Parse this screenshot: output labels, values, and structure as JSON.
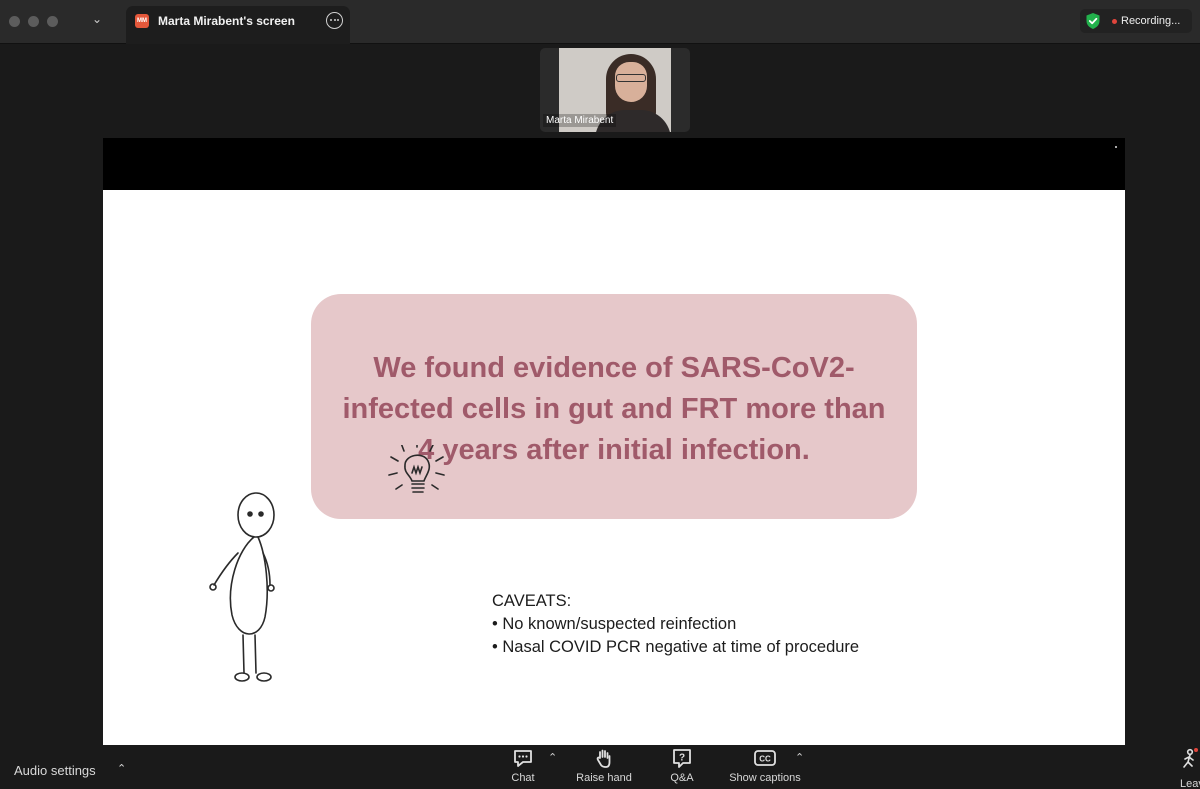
{
  "window": {
    "tab_title": "Marta Mirabent's screen",
    "app_icon_text": "MM",
    "recording_label": "Recording..."
  },
  "speaker": {
    "name": "Marta Mirabent"
  },
  "slide": {
    "headline_lines": [
      "We found evidence of SARS-CoV2-",
      "infected cells in gut and FRT more than",
      "4 years after initial infection."
    ],
    "caveats_title": "CAVEATS:",
    "caveats": [
      "• No known/suspected reinfection",
      "• Nasal COVID PCR negative at time of procedure"
    ],
    "colors": {
      "callout_bg": "#e6c8ca",
      "headline": "#a05a6a"
    }
  },
  "toolbar": {
    "audio_settings": "Audio settings",
    "chat": "Chat",
    "raise_hand": "Raise hand",
    "qa": "Q&A",
    "show_captions": "Show captions",
    "leave": "Leave"
  },
  "icons": {
    "recording": "shield-check-icon",
    "chat": "chat-bubble-icon",
    "raise_hand": "hand-icon",
    "qa": "question-icon",
    "captions": "cc-icon",
    "leave": "leave-icon"
  }
}
